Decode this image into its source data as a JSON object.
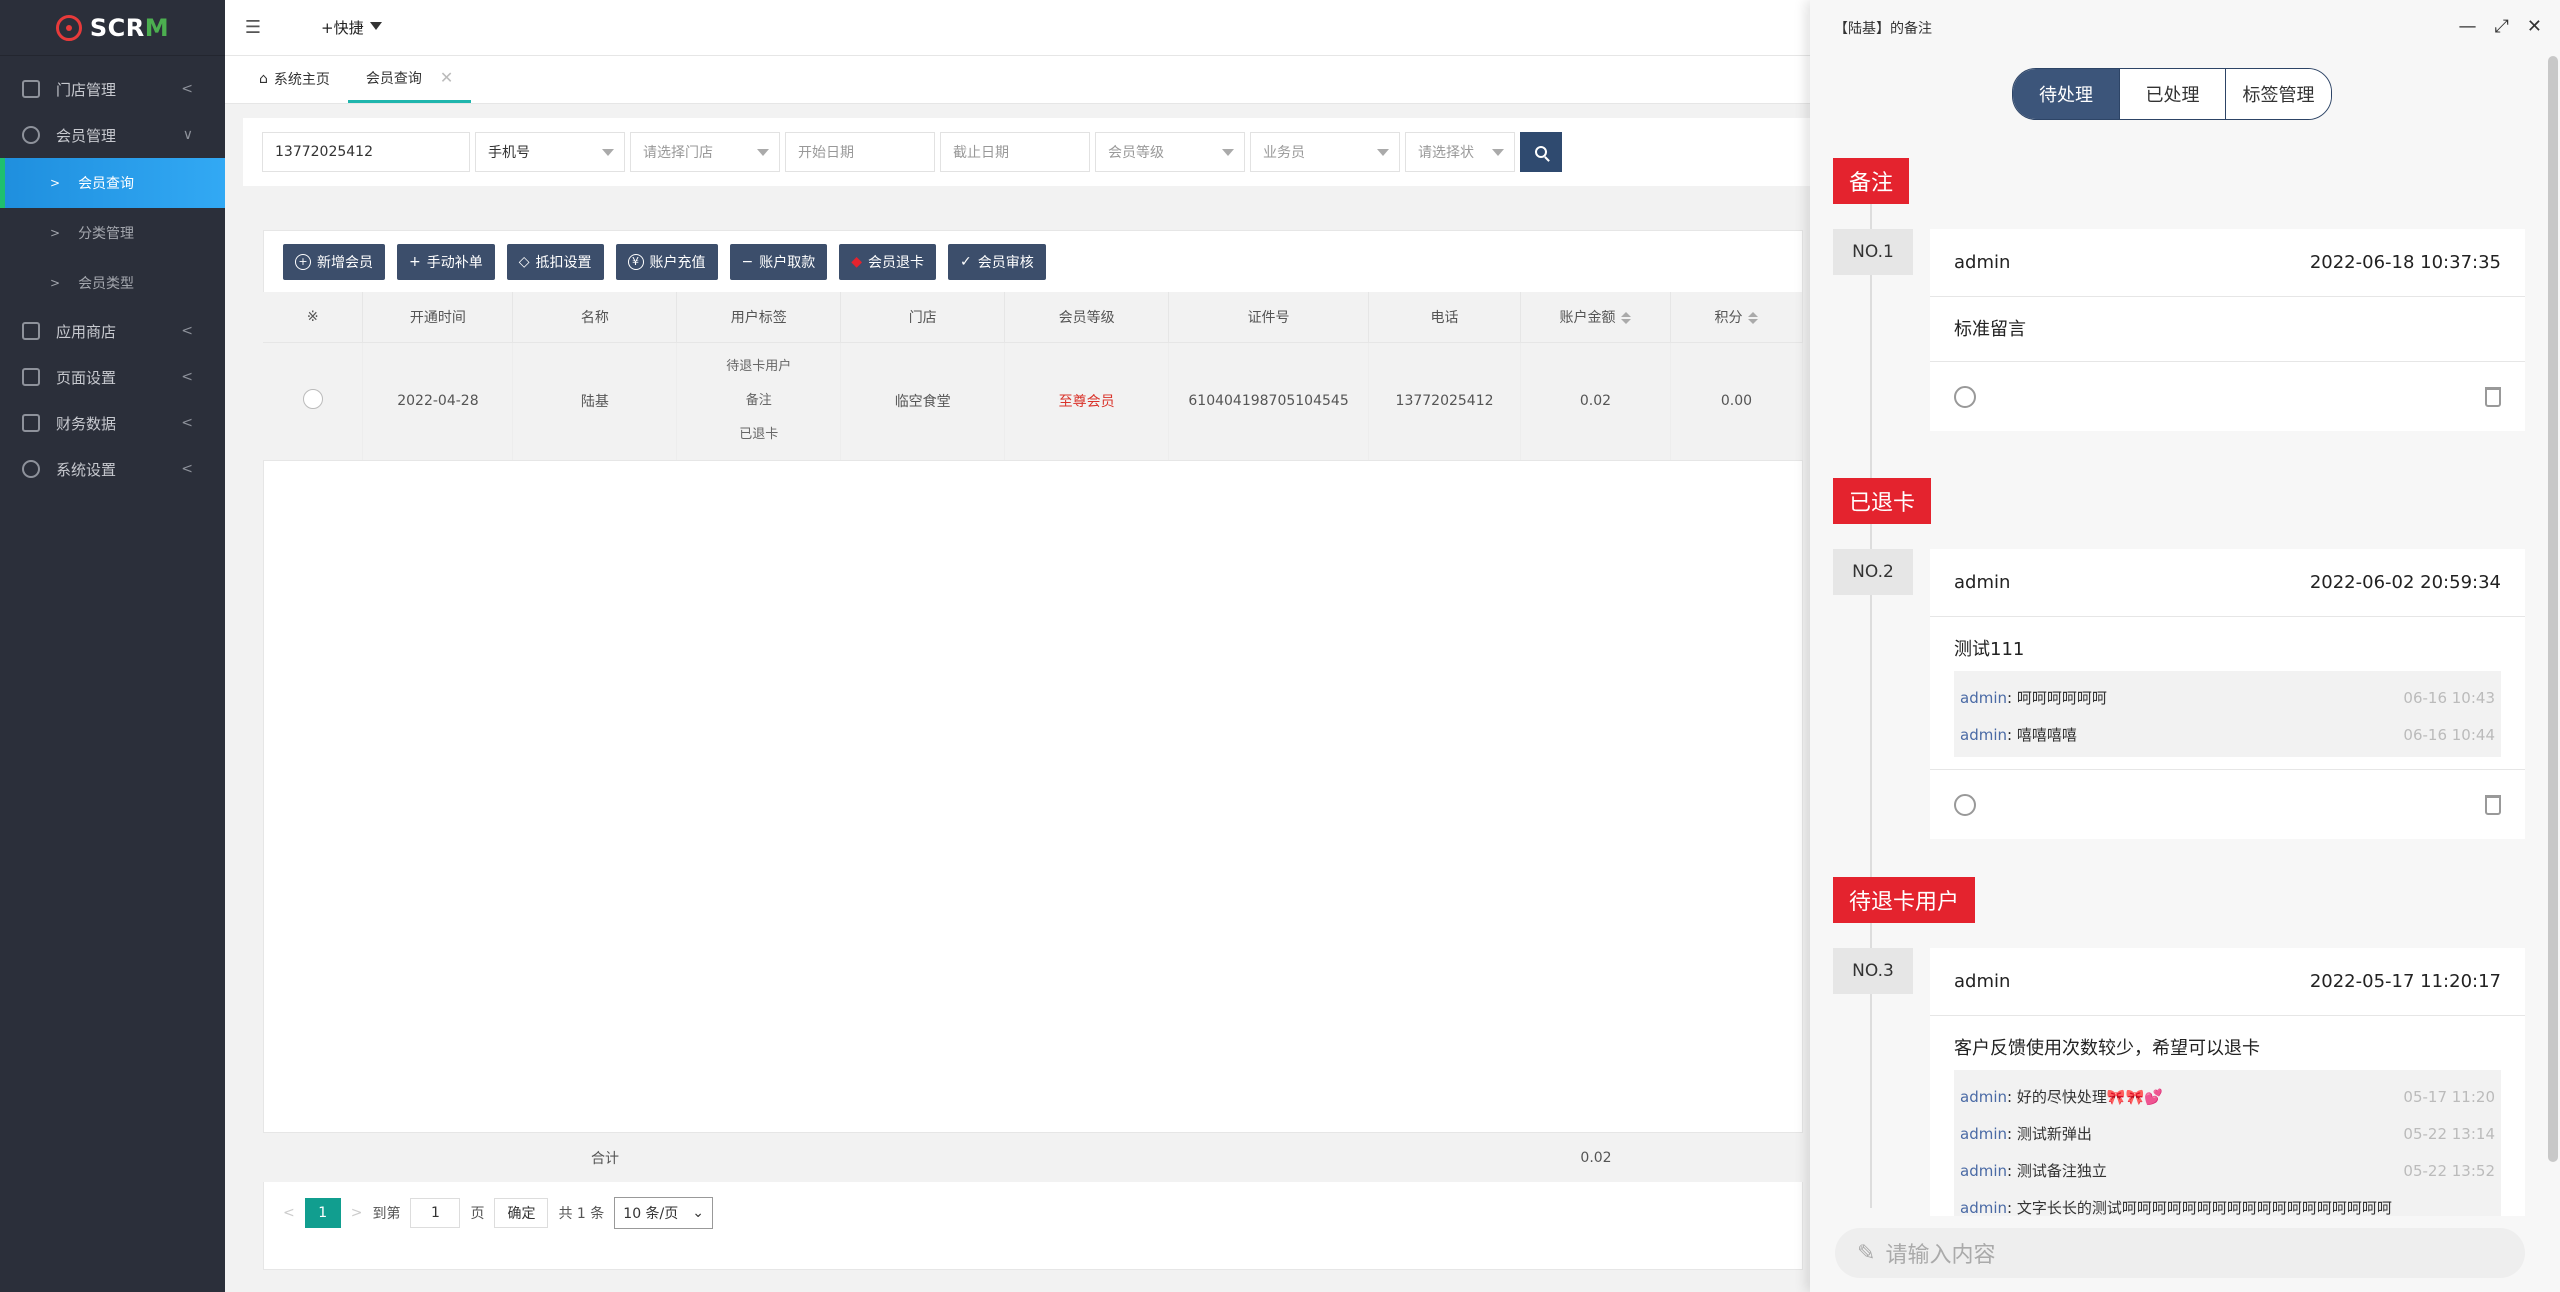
{
  "app": {
    "logo_text": "SCRM"
  },
  "sidebar": {
    "items": [
      {
        "label": "门店管理"
      },
      {
        "label": "会员管理"
      },
      {
        "label": "应用商店"
      },
      {
        "label": "页面设置"
      },
      {
        "label": "财务数据"
      },
      {
        "label": "系统设置"
      }
    ],
    "subitems": [
      {
        "label": "会员查询"
      },
      {
        "label": "分类管理"
      },
      {
        "label": "会员类型"
      }
    ]
  },
  "topbar": {
    "quick_label": "+快捷"
  },
  "tabs": [
    {
      "label": "系统主页"
    },
    {
      "label": "会员查询"
    }
  ],
  "filter": {
    "phone_value": "13772025412",
    "phone_type": "手机号",
    "store_placeholder": "请选择门店",
    "start_placeholder": "开始日期",
    "end_placeholder": "截止日期",
    "level_placeholder": "会员等级",
    "sales_placeholder": "业务员",
    "status_placeholder": "请选择状"
  },
  "toolbar": {
    "add": "新增会员",
    "manual": "手动补单",
    "deduct": "抵扣设置",
    "recharge": "账户充值",
    "withdraw": "账户取款",
    "refund": "会员退卡",
    "review": "会员审核"
  },
  "table": {
    "headers": [
      "※",
      "开通时间",
      "名称",
      "用户标签",
      "门店",
      "会员等级",
      "证件号",
      "电话",
      "账户金额",
      "积分"
    ],
    "row": {
      "date": "2022-04-28",
      "name": "陆基",
      "tags": [
        "待退卡用户",
        "备注",
        "已退卡"
      ],
      "store": "临空食堂",
      "level": "至尊会员",
      "id_no": "610404198705104545",
      "phone": "13772025412",
      "balance": "0.02",
      "points": "0.00"
    },
    "sum_label": "合计",
    "sum_balance": "0.02"
  },
  "pager": {
    "current": "1",
    "goto_label": "到第",
    "page_input": "1",
    "page_unit": "页",
    "confirm": "确定",
    "total": "共 1 条",
    "per_page": "10 条/页"
  },
  "drawer": {
    "title": "【陆基】的备注",
    "segments": [
      "待处理",
      "已处理",
      "标签管理"
    ],
    "groups": [
      {
        "tag": "备注",
        "no": "NO.1",
        "user": "admin",
        "time": "2022-06-18 10:37:35",
        "content": "标准留言",
        "replies": []
      },
      {
        "tag": "已退卡",
        "no": "NO.2",
        "user": "admin",
        "time": "2022-06-02 20:59:34",
        "content": "测试111",
        "replies": [
          {
            "who": "admin",
            "msg": "呵呵呵呵呵呵",
            "t": "06-16 10:43"
          },
          {
            "who": "admin",
            "msg": "嘻嘻嘻嘻",
            "t": "06-16 10:44"
          }
        ]
      },
      {
        "tag": "待退卡用户",
        "no": "NO.3",
        "user": "admin",
        "time": "2022-05-17 11:20:17",
        "content": "客户反馈使用次数较少，希望可以退卡",
        "replies": [
          {
            "who": "admin",
            "msg": "好的尽快处理🎀🎀💕",
            "t": "05-17 11:20"
          },
          {
            "who": "admin",
            "msg": "测试新弹出",
            "t": "05-22 13:14"
          },
          {
            "who": "admin",
            "msg": "测试备注独立",
            "t": "05-22 13:52"
          },
          {
            "who": "admin",
            "msg": "文字长长的测试呵呵呵呵呵呵呵呵呵呵呵呵呵呵呵呵呵呵",
            "t": ""
          }
        ]
      }
    ],
    "input_placeholder": "请输入内容"
  }
}
